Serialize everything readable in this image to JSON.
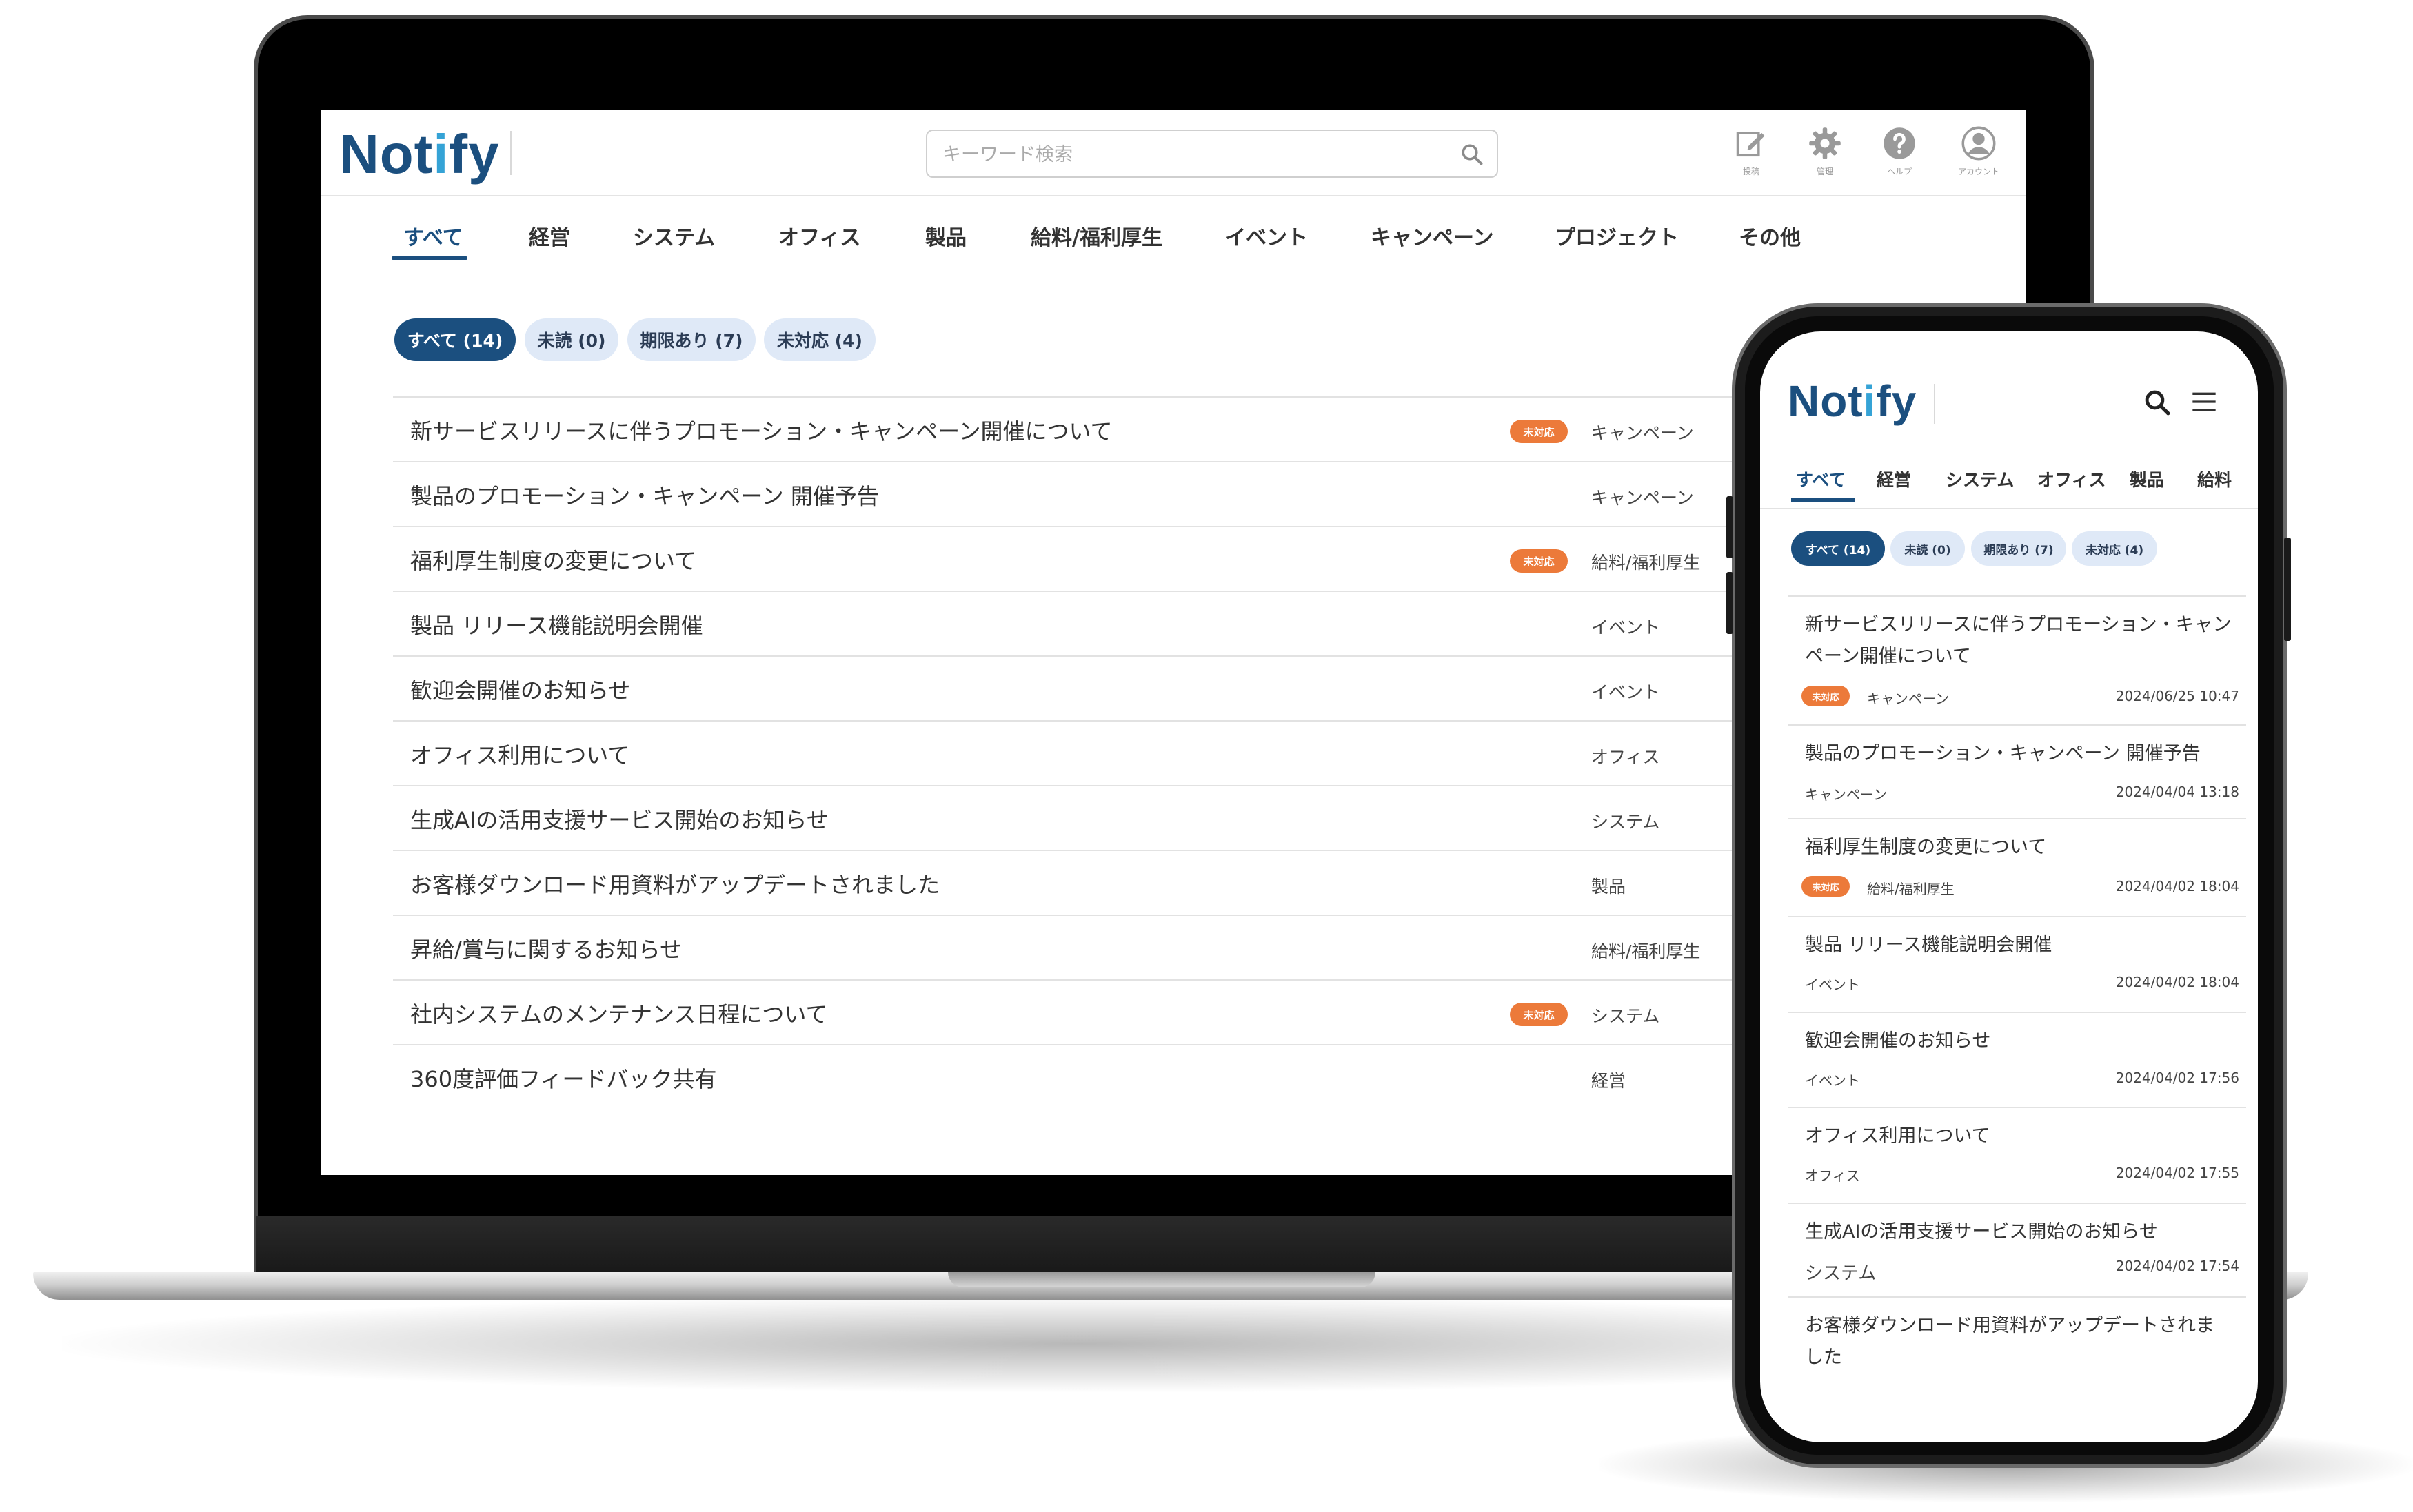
{
  "desktop": {
    "logo": {
      "text": "Notify"
    },
    "search": {
      "placeholder": "キーワード検索"
    },
    "toolbar": [
      {
        "label": "投稿",
        "icon": "edit-icon"
      },
      {
        "label": "管理",
        "icon": "gear-icon"
      },
      {
        "label": "ヘルプ",
        "icon": "help-icon"
      },
      {
        "label": "アカウント",
        "icon": "account-icon"
      }
    ],
    "tabs": [
      "すべて",
      "経営",
      "システム",
      "オフィス",
      "製品",
      "給料/福利厚生",
      "イベント",
      "キャンペーン",
      "プロジェクト",
      "その他"
    ],
    "active_tab": "すべて",
    "filters": [
      "すべて (14)",
      "未読 (0)",
      "期限あり (7)",
      "未対応 (4)"
    ],
    "active_filter": "すべて (14)",
    "items": [
      {
        "title": "新サービスリリースに伴うプロモーション・キャンペーン開催について",
        "badge": "未対応",
        "category": "キャンペーン"
      },
      {
        "title": "製品のプロモーション・キャンペーン 開催予告",
        "badge": "",
        "category": "キャンペーン"
      },
      {
        "title": "福利厚生制度の変更について",
        "badge": "未対応",
        "category": "給料/福利厚生"
      },
      {
        "title": "製品 リリース機能説明会開催",
        "badge": "",
        "category": "イベント"
      },
      {
        "title": "歓迎会開催のお知らせ",
        "badge": "",
        "category": "イベント"
      },
      {
        "title": "オフィス利用について",
        "badge": "",
        "category": "オフィス"
      },
      {
        "title": "生成AIの活用支援サービス開始のお知らせ",
        "badge": "",
        "category": "システム"
      },
      {
        "title": "お客様ダウンロード用資料がアップデートされました",
        "badge": "",
        "category": "製品"
      },
      {
        "title": "昇給/賞与に関するお知らせ",
        "badge": "",
        "category": "給料/福利厚生"
      },
      {
        "title": "社内システムのメンテナンス日程について",
        "badge": "未対応",
        "category": "システム"
      },
      {
        "title": "360度評価フィードバック共有",
        "badge": "",
        "category": "経営"
      }
    ]
  },
  "mobile": {
    "logo": {
      "text": "Notify"
    },
    "tabs": [
      "すべて",
      "経営",
      "システム",
      "オフィス",
      "製品",
      "給料"
    ],
    "filters": [
      "すべて (14)",
      "未読 (0)",
      "期限あり (7)",
      "未対応 (4)"
    ],
    "items": [
      {
        "title": "新サービスリリースに伴うプロモーション・キャンペーン開催について",
        "badge": "未対応",
        "category": "キャンペーン",
        "date": "2024/06/25 10:47"
      },
      {
        "title": "製品のプロモーション・キャンペーン 開催予告",
        "badge": "",
        "category": "キャンペーン",
        "date": "2024/04/04 13:18"
      },
      {
        "title": "福利厚生制度の変更について",
        "badge": "未対応",
        "category": "給料/福利厚生",
        "date": "2024/04/02 18:04"
      },
      {
        "title": "製品 リリース機能説明会開催",
        "badge": "",
        "category": "イベント",
        "date": "2024/04/02 18:04"
      },
      {
        "title": "歓迎会開催のお知らせ",
        "badge": "",
        "category": "イベント",
        "date": "2024/04/02 17:56"
      },
      {
        "title": "オフィス利用について",
        "badge": "",
        "category": "オフィス",
        "date": "2024/04/02 17:55"
      },
      {
        "title": "生成AIの活用支援サービス開始のお知らせ",
        "badge": "",
        "category": "システム",
        "date": "2024/04/02 17:54"
      },
      {
        "title": "お客様ダウンロード用資料がアップデートされました",
        "badge": "",
        "category": "",
        "date": ""
      }
    ]
  },
  "colors": {
    "brand": "#1b4f7f",
    "chip_bg": "#dfe9f7",
    "badge": "#ec7a3a",
    "logo_dot": "#35a3d6"
  }
}
